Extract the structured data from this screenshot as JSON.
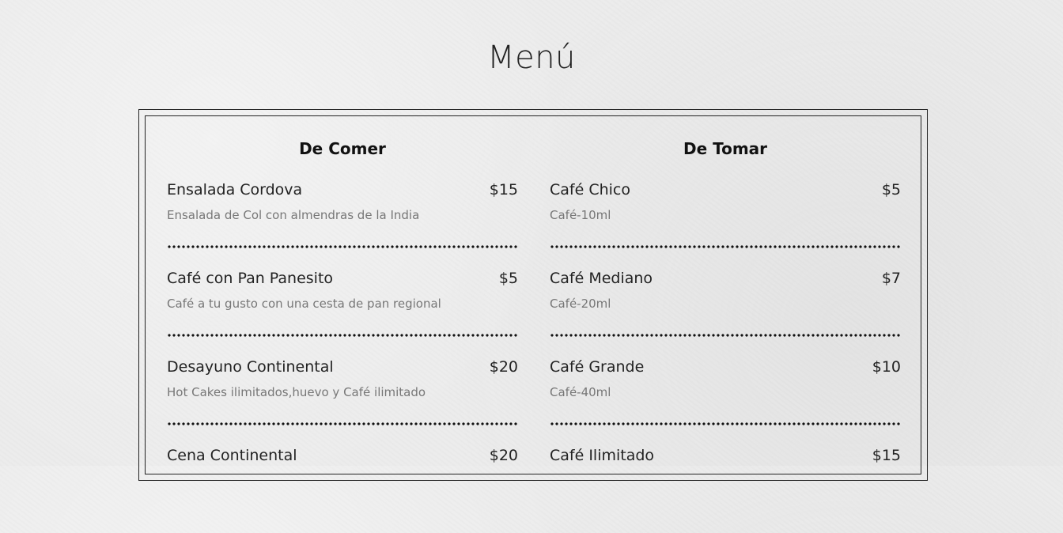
{
  "page": {
    "title": "Menú"
  },
  "menu": {
    "food": {
      "title": "De Comer",
      "items": [
        {
          "name": "Ensalada Cordova",
          "price": "$15",
          "description": "Ensalada de Col con almendras de la India"
        },
        {
          "name": "Café con Pan Panesito",
          "price": "$5",
          "description": "Café a tu gusto con una cesta de pan regional"
        },
        {
          "name": "Desayuno Continental",
          "price": "$20",
          "description": "Hot Cakes ilimitados,huevo y Café ilimitado"
        },
        {
          "name": "Cena Continental",
          "price": "$20",
          "description": ""
        }
      ]
    },
    "drinks": {
      "title": "De Tomar",
      "items": [
        {
          "name": "Café Chico",
          "price": "$5",
          "description": "Café-10ml"
        },
        {
          "name": "Café Mediano",
          "price": "$7",
          "description": "Café-20ml"
        },
        {
          "name": "Café Grande",
          "price": "$10",
          "description": "Café-40ml"
        },
        {
          "name": "Café Ilimitado",
          "price": "$15",
          "description": ""
        }
      ]
    }
  }
}
